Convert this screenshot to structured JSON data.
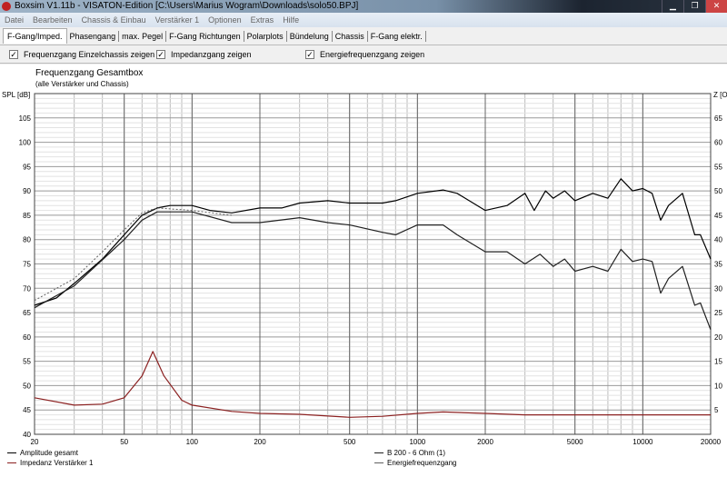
{
  "window": {
    "title": "Boxsim V1.11b - VISATON-Edition [C:\\Users\\Marius Wogram\\Downloads\\solo50.BPJ]"
  },
  "menu": [
    "Datei",
    "Bearbeiten",
    "Chassis & Einbau",
    "Verstärker 1",
    "Optionen",
    "Extras",
    "Hilfe"
  ],
  "tabs": [
    "F-Gang/Imped.",
    "Phasengang",
    "max. Pegel",
    "F-Gang Richtungen",
    "Polarplots",
    "Bündelung",
    "Chassis",
    "F-Gang elektr."
  ],
  "options": [
    {
      "label": "Frequenzgang Einzelchassis zeigen",
      "checked": true
    },
    {
      "label": "Impedanzgang zeigen",
      "checked": true
    },
    {
      "label": "Energiefrequenzgang zeigen",
      "checked": true
    }
  ],
  "chart_data": {
    "type": "line",
    "title": "Frequenzgang Gesamtbox",
    "subtitle": "(alle Verstärker und Chassis)",
    "ylabel": "SPL [dB]",
    "y2label": "Z [Ohm]",
    "xscale": "log",
    "xlim": [
      20,
      20000
    ],
    "ylim": [
      40,
      110
    ],
    "y2lim": [
      0,
      70
    ],
    "xticks": [
      20,
      50,
      100,
      200,
      500,
      1000,
      2000,
      5000,
      10000,
      20000
    ],
    "yticks": [
      40,
      45,
      50,
      55,
      60,
      65,
      70,
      75,
      80,
      85,
      90,
      95,
      100,
      105
    ],
    "y2ticks": [
      5,
      10,
      15,
      20,
      25,
      30,
      35,
      40,
      45,
      50,
      55,
      60,
      65
    ],
    "series": [
      {
        "name": "Amplitude gesamt",
        "color": "#000000",
        "axis": "left",
        "style": "solid",
        "x": [
          20,
          25,
          30,
          40,
          50,
          60,
          70,
          80,
          100,
          120,
          150,
          200,
          250,
          300,
          400,
          500,
          700,
          800,
          1000,
          1300,
          1500,
          2000,
          2500,
          3000,
          3300,
          3700,
          4000,
          4500,
          5000,
          6000,
          7000,
          8000,
          9000,
          10000,
          11000,
          12000,
          13000,
          15000,
          17000,
          18000,
          20000
        ],
        "y": [
          66.5,
          68,
          71,
          76,
          81,
          85,
          86.5,
          87,
          87,
          86,
          85.5,
          86.5,
          86.5,
          87.5,
          88,
          87.5,
          87.5,
          88,
          89.5,
          90.2,
          89.5,
          86,
          87,
          89.5,
          86,
          90,
          88.5,
          90,
          88,
          89.5,
          88.5,
          92.5,
          90,
          90.5,
          89.5,
          84,
          87,
          89.5,
          81,
          81,
          76
        ]
      },
      {
        "name": "B 200 - 6 Ohm (1)",
        "color": "#202020",
        "axis": "left",
        "style": "solid",
        "x": [
          20,
          30,
          50,
          60,
          70,
          100,
          150,
          200,
          300,
          400,
          500,
          700,
          800,
          1000,
          1300,
          1500,
          2000,
          2500,
          3000,
          3500,
          4000,
          4500,
          5000,
          6000,
          7000,
          8000,
          9000,
          10000,
          11000,
          12000,
          13000,
          15000,
          17000,
          18000,
          20000
        ],
        "y": [
          66,
          70.5,
          80,
          84,
          85.7,
          85.7,
          83.5,
          83.5,
          84.5,
          83.5,
          83,
          81.5,
          81,
          83,
          83,
          81,
          77.5,
          77.5,
          75,
          77,
          74.5,
          76,
          73.5,
          74.5,
          73.5,
          78,
          75.5,
          76,
          75.5,
          69,
          72,
          74.5,
          66.5,
          67,
          61.5
        ]
      },
      {
        "name": "Energiefrequenzgang",
        "color": "#606060",
        "axis": "left",
        "style": "dotted",
        "x": [
          20,
          30,
          40,
          50,
          60,
          70,
          100,
          150
        ],
        "y": [
          67.5,
          72,
          77.5,
          82,
          85.5,
          86.5,
          86,
          85
        ]
      },
      {
        "name": "Impedanz Verstärker 1",
        "color": "#8b2020",
        "axis": "right",
        "style": "solid",
        "x": [
          20,
          30,
          40,
          50,
          60,
          67,
          75,
          90,
          100,
          150,
          200,
          300,
          500,
          700,
          1000,
          1300,
          2000,
          3000,
          5000,
          20000
        ],
        "y": [
          7.5,
          6,
          6.2,
          7.5,
          12,
          17,
          12,
          7,
          6,
          4.7,
          4.3,
          4.1,
          3.5,
          3.7,
          4.3,
          4.6,
          4.3,
          4,
          4,
          4
        ]
      }
    ]
  }
}
